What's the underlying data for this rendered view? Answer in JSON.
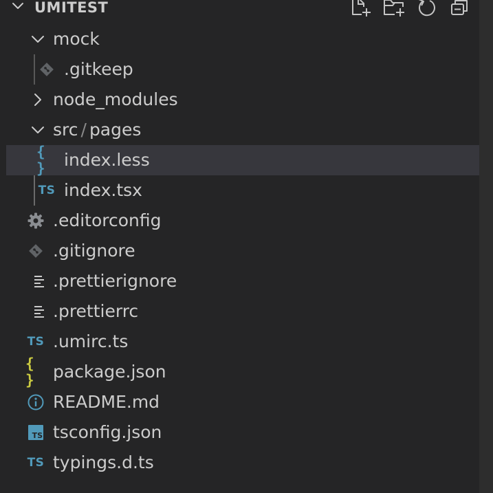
{
  "explorer": {
    "title": "UMITEST",
    "actions": [
      "new-file-icon",
      "new-folder-icon",
      "refresh-icon",
      "collapse-all-icon"
    ]
  },
  "tree": [
    {
      "label": "mock",
      "type": "folder",
      "expanded": true,
      "icon": "chevron-down-icon"
    },
    {
      "label": ".gitkeep",
      "type": "file",
      "icon": "git-icon",
      "icon_color": "#606366"
    },
    {
      "label": "node_modules",
      "type": "folder",
      "expanded": false,
      "icon": "chevron-right-icon"
    },
    {
      "label": "src",
      "label_sep": "/",
      "label2": "pages",
      "type": "folder",
      "expanded": true,
      "icon": "chevron-down-icon"
    },
    {
      "label": "index.less",
      "type": "file",
      "icon": "braces-icon",
      "icon_text": "{ }",
      "icon_color": "#519aba",
      "selected": true
    },
    {
      "label": "index.tsx",
      "type": "file",
      "icon": "typescript-icon",
      "icon_text": "TS",
      "icon_color": "#519aba"
    },
    {
      "label": ".editorconfig",
      "type": "file",
      "icon": "gear-icon",
      "icon_color": "#8a8d91"
    },
    {
      "label": ".gitignore",
      "type": "file",
      "icon": "git-icon",
      "icon_color": "#606366"
    },
    {
      "label": ".prettierignore",
      "type": "file",
      "icon": "text-lines-icon",
      "icon_color": "#cccccc"
    },
    {
      "label": ".prettierrc",
      "type": "file",
      "icon": "text-lines-icon",
      "icon_color": "#cccccc"
    },
    {
      "label": ".umirc.ts",
      "type": "file",
      "icon": "typescript-icon",
      "icon_text": "TS",
      "icon_color": "#519aba"
    },
    {
      "label": "package.json",
      "type": "file",
      "icon": "json-icon",
      "icon_text": "{ }",
      "icon_color": "#cbcb41"
    },
    {
      "label": "README.md",
      "type": "file",
      "icon": "info-icon",
      "icon_color": "#519aba"
    },
    {
      "label": "tsconfig.json",
      "type": "file",
      "icon": "tsconfig-icon",
      "icon_text": "TS",
      "icon_color": "#519aba"
    },
    {
      "label": "typings.d.ts",
      "type": "file",
      "icon": "typescript-icon",
      "icon_text": "TS",
      "icon_color": "#519aba"
    }
  ]
}
